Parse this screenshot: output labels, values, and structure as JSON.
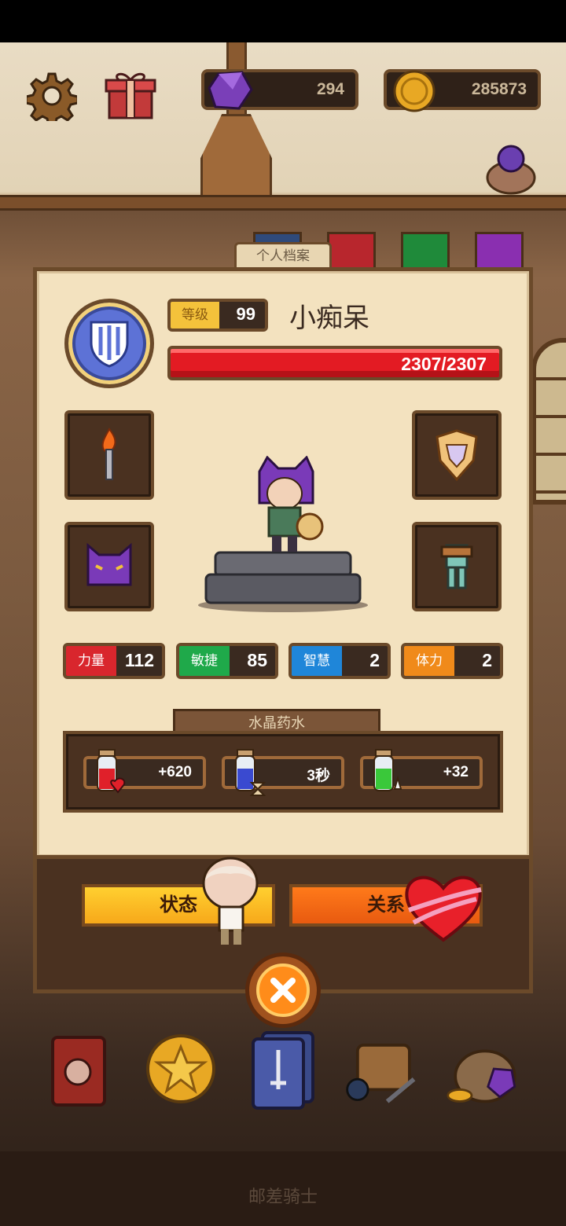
{
  "hud": {
    "gems": "294",
    "coins": "285873"
  },
  "profile_tab": "个人档案",
  "character": {
    "level_label": "等级",
    "level": "99",
    "name": "小痴呆",
    "hp": "2307/2307"
  },
  "stats": [
    {
      "label": "力量",
      "value": "112",
      "color": "#d9262d"
    },
    {
      "label": "敏捷",
      "value": "85",
      "color": "#1fa94a"
    },
    {
      "label": "智慧",
      "value": "2",
      "color": "#1f86d9"
    },
    {
      "label": "体力",
      "value": "2",
      "color": "#f08a1a"
    }
  ],
  "potions": {
    "title": "水晶药水",
    "items": [
      {
        "value": "+620",
        "icon": "red-heart-potion-icon"
      },
      {
        "value": "3秒",
        "icon": "blue-hourglass-potion-icon"
      },
      {
        "value": "+32",
        "icon": "green-sword-potion-icon"
      }
    ]
  },
  "buttons": {
    "status": "状态",
    "relation": "关系"
  },
  "footer": "邮差骑士"
}
